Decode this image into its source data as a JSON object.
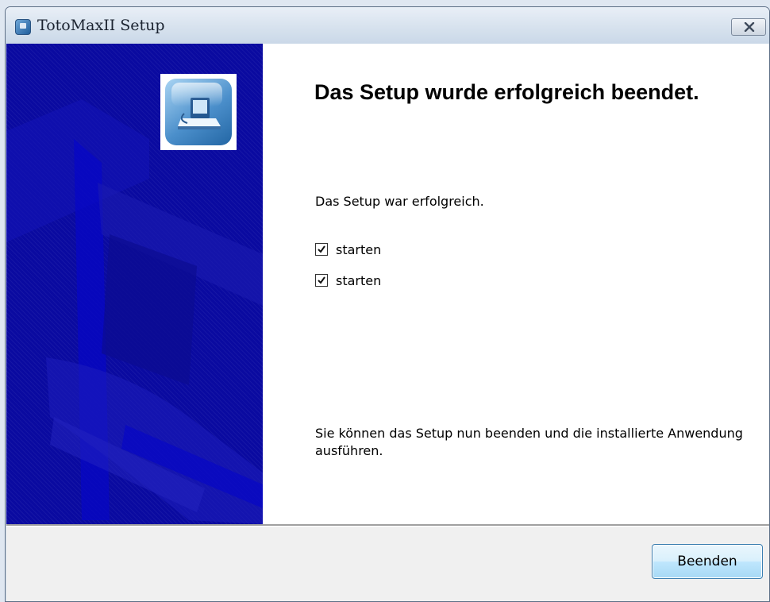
{
  "window": {
    "title": "TotoMaxII Setup",
    "app_icon": "installer-app-icon",
    "close_icon": "close-x-icon"
  },
  "side_panel": {
    "logo_icon": "computer-setup-icon",
    "background_color": "#0a0aa0"
  },
  "content": {
    "heading": "Das Setup wurde erfolgreich beendet.",
    "message": "Das Setup war erfolgreich.",
    "checkboxes": [
      {
        "label": "starten",
        "checked": true
      },
      {
        "label": "starten",
        "checked": true
      }
    ],
    "footer_message": "Sie können das Setup nun beenden und die installierte Anwendung ausführen."
  },
  "buttons": {
    "finish_label": "Beenden"
  },
  "colors": {
    "button_border": "#3c7fb1",
    "titlebar": "#d7e2ee"
  }
}
